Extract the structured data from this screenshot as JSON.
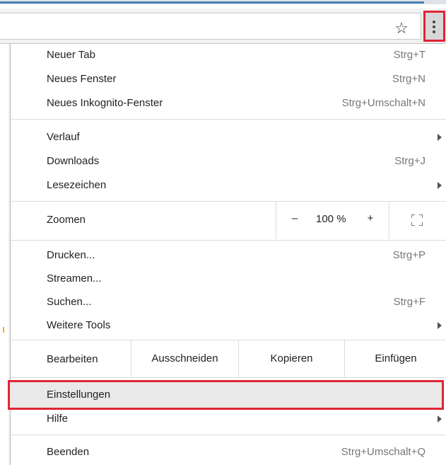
{
  "toolbar": {
    "star_icon": "star-icon",
    "menu_icon": "three-dots-vertical-icon",
    "accent_colors": {
      "highlight": "#e02434",
      "tab_bar": "#4a7fb5"
    }
  },
  "menu": {
    "new_tab": {
      "label": "Neuer Tab",
      "shortcut": "Strg+T"
    },
    "new_window": {
      "label": "Neues Fenster",
      "shortcut": "Strg+N"
    },
    "incognito": {
      "label": "Neues Inkognito-Fenster",
      "shortcut": "Strg+Umschalt+N"
    },
    "history": {
      "label": "Verlauf"
    },
    "downloads": {
      "label": "Downloads",
      "shortcut": "Strg+J"
    },
    "bookmarks": {
      "label": "Lesezeichen"
    },
    "zoom": {
      "label": "Zoomen",
      "minus": "–",
      "value": "100 %",
      "plus": "+"
    },
    "print": {
      "label": "Drucken...",
      "shortcut": "Strg+P"
    },
    "cast": {
      "label": "Streamen..."
    },
    "find": {
      "label": "Suchen...",
      "shortcut": "Strg+F"
    },
    "more_tools": {
      "label": "Weitere Tools"
    },
    "edit": {
      "label": "Bearbeiten",
      "cut": "Ausschneiden",
      "copy": "Kopieren",
      "paste": "Einfügen"
    },
    "settings": {
      "label": "Einstellungen"
    },
    "help": {
      "label": "Hilfe"
    },
    "exit": {
      "label": "Beenden",
      "shortcut": "Strg+Umschalt+Q"
    }
  }
}
